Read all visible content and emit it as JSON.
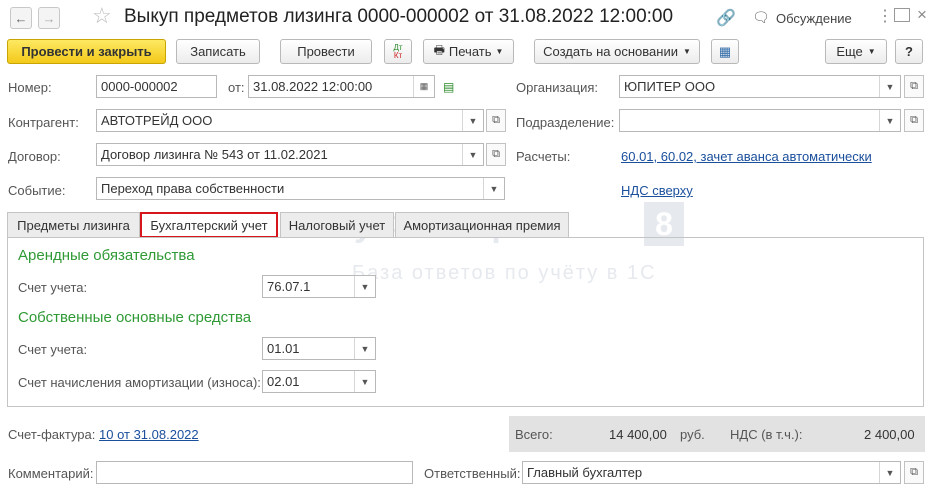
{
  "header": {
    "title": "Выкуп предметов лизинга 0000-000002 от 31.08.2022 12:00:00",
    "discussion_label": "Обсуждение"
  },
  "toolbar": {
    "post_close": "Провести и закрыть",
    "write": "Записать",
    "post": "Провести",
    "dtkt_top": "Дт",
    "dtkt_bottom": "Кт",
    "print": "Печать",
    "create_based": "Создать на основании",
    "more": "Еще",
    "help": "?"
  },
  "form": {
    "number_label": "Номер:",
    "number_value": "0000-000002",
    "date_label": "от:",
    "date_value": "31.08.2022 12:00:00",
    "org_label": "Организация:",
    "org_value": "ЮПИТЕР ООО",
    "counterparty_label": "Контрагент:",
    "counterparty_value": "АВТОТРЕЙД ООО",
    "division_label": "Подразделение:",
    "division_value": "",
    "contract_label": "Договор:",
    "contract_value": "Договор лизинга № 543 от 11.02.2021",
    "settlements_label": "Расчеты:",
    "settlements_link": "60.01, 60.02, зачет аванса автоматически",
    "event_label": "Событие:",
    "event_value": "Переход права собственности",
    "vat_link": "НДС сверху"
  },
  "tabs": [
    {
      "label": "Предметы лизинга"
    },
    {
      "label": "Бухгалтерский учет"
    },
    {
      "label": "Налоговый учет"
    },
    {
      "label": "Амортизационная премия"
    }
  ],
  "accounting": {
    "lease_heading": "Арендные обязательства",
    "lease_account_label": "Счет учета:",
    "lease_account_value": "76.07.1",
    "own_heading": "Собственные основные средства",
    "own_account_label": "Счет учета:",
    "own_account_value": "01.01",
    "depr_label": "Счет начисления амортизации (износа):",
    "depr_value": "02.01"
  },
  "footer": {
    "invoice_label": "Счет-фактура:",
    "invoice_link": "10 от 31.08.2022",
    "total_label": "Всего:",
    "total_value": "14 400,00",
    "currency": "руб.",
    "vat_label": "НДС (в т.ч.):",
    "vat_value": "2 400,00",
    "comment_label": "Комментарий:",
    "comment_value": "",
    "responsible_label": "Ответственный:",
    "responsible_value": "Главный бухгалтер"
  },
  "watermark": {
    "brand": "БухЭксперт",
    "badge": "8",
    "tagline": "База ответов по учёту в 1С"
  },
  "colors": {
    "primary_button": "#f5cf22",
    "section_heading": "#2f9a35",
    "link": "#1a4f9c",
    "active_tab_border": "#d6161c"
  }
}
